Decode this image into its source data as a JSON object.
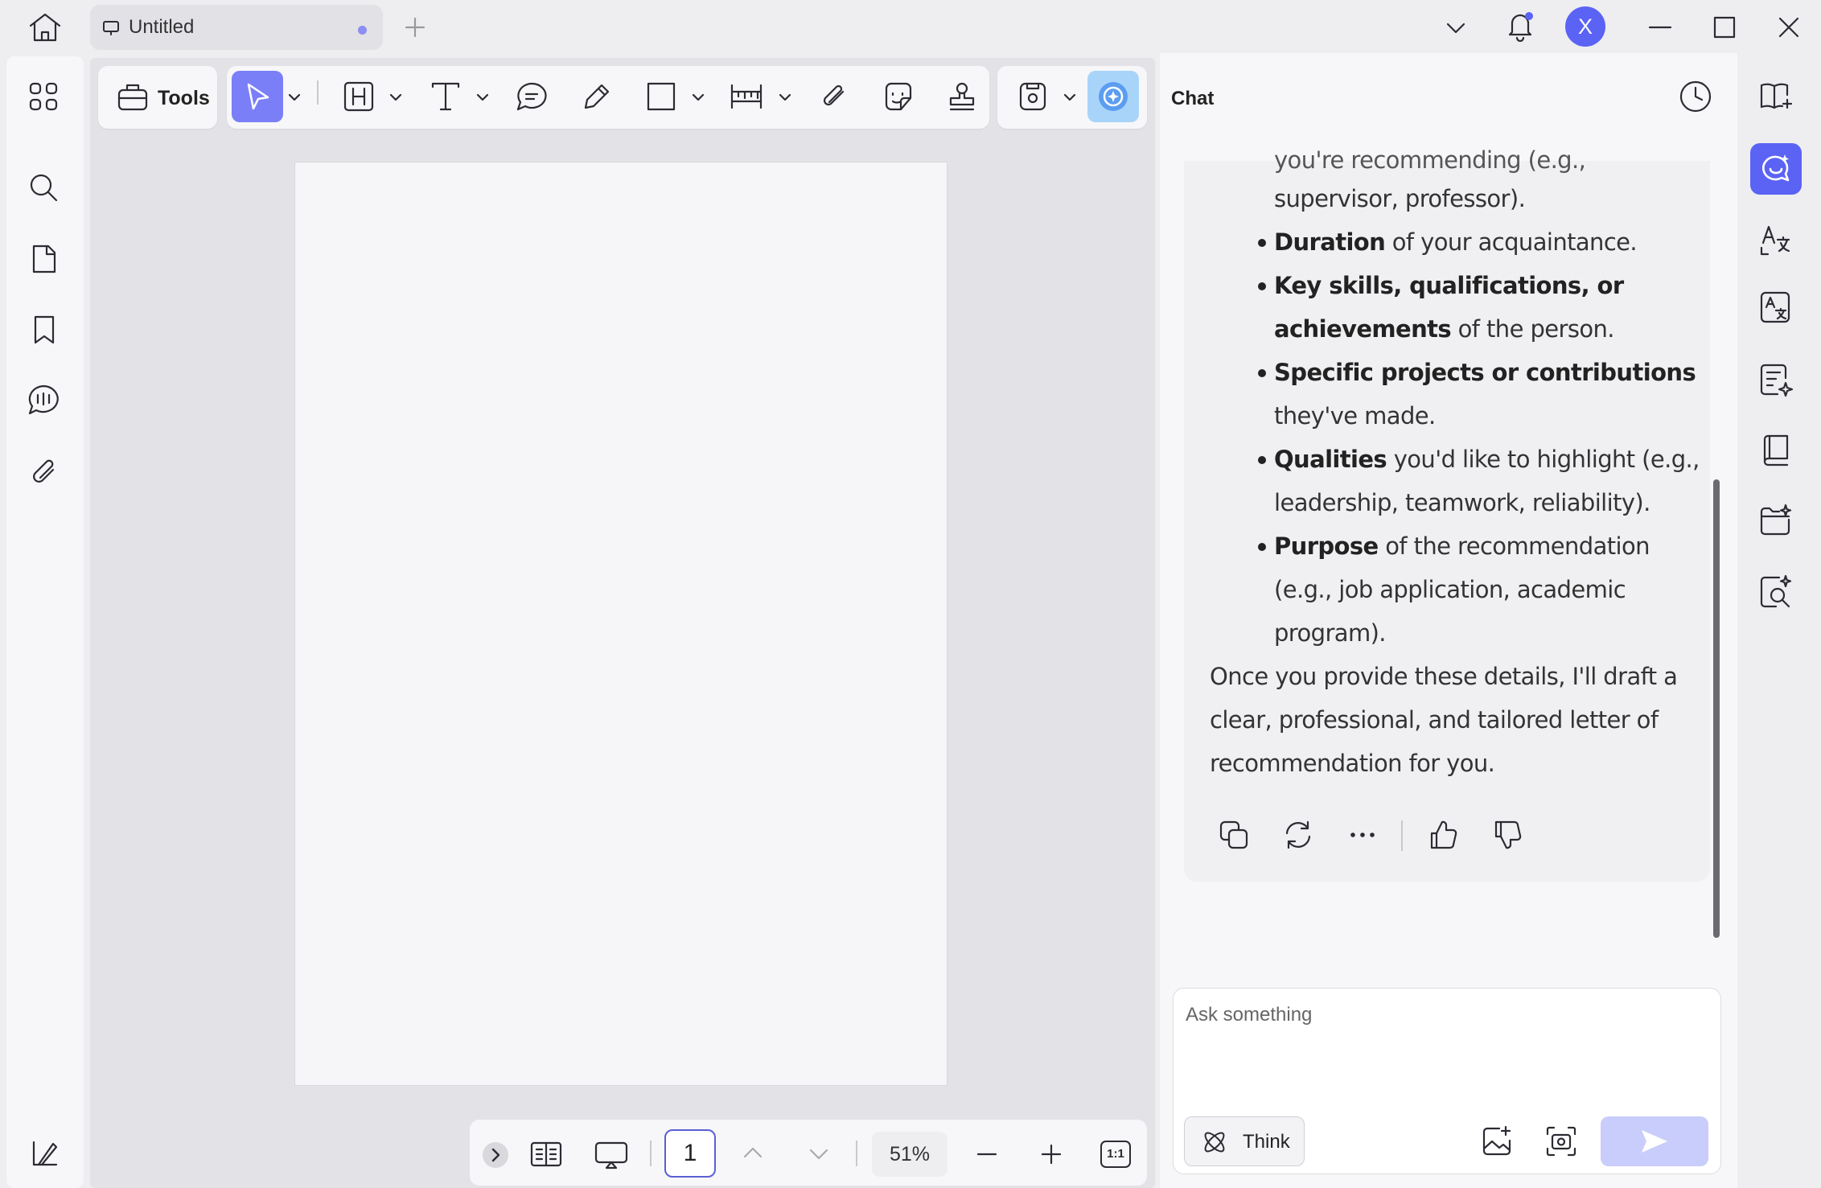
{
  "titlebar": {
    "tab_title": "Untitled",
    "user_initial": "X",
    "avatar_color": "#5b63f5"
  },
  "toolbar": {
    "tools_label": "Tools",
    "accent": "#7b7ff7"
  },
  "bottombar": {
    "page_number": "1",
    "zoom_level": "51%",
    "actual_size_label": "1:1"
  },
  "chat": {
    "title": "Chat",
    "message": {
      "line_cut": "you're recommending (e.g.,",
      "line_0": "supervisor, professor).",
      "b1_bold": "Duration",
      "b1_rest": " of your acquaintance.",
      "b2_bold": "Key skills, qualifications, or",
      "b2_bold2": "achievements",
      "b2_rest": " of the person.",
      "b3_bold": "Specific projects or contributions",
      "b3_rest": "they've made.",
      "b4_bold": "Qualities",
      "b4_rest": " you'd like to highlight (e.g.,",
      "b4_rest2": "leadership, teamwork, reliability).",
      "b5_bold": "Purpose",
      "b5_rest": " of the recommendation",
      "b5_rest2": "(e.g., job application, academic",
      "b5_rest3": "program).",
      "closing_1": "Once you provide these details, I'll draft a",
      "closing_2": "clear, professional, and tailored letter of",
      "closing_3": "recommendation for you."
    },
    "input_placeholder": "Ask something",
    "think_label": "Think"
  }
}
